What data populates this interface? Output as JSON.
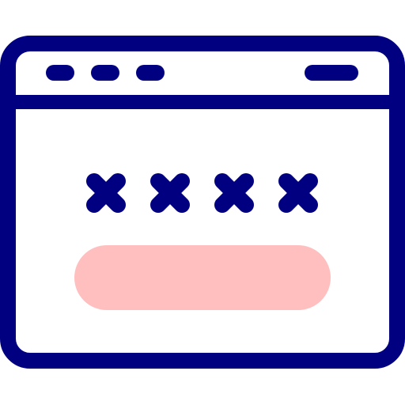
{
  "icon": {
    "name": "password-browser-window-icon",
    "colors": {
      "stroke": "#000080",
      "accent": "#FFBFBF",
      "background": "#FFFFFF"
    },
    "password_mask_count": 4
  }
}
